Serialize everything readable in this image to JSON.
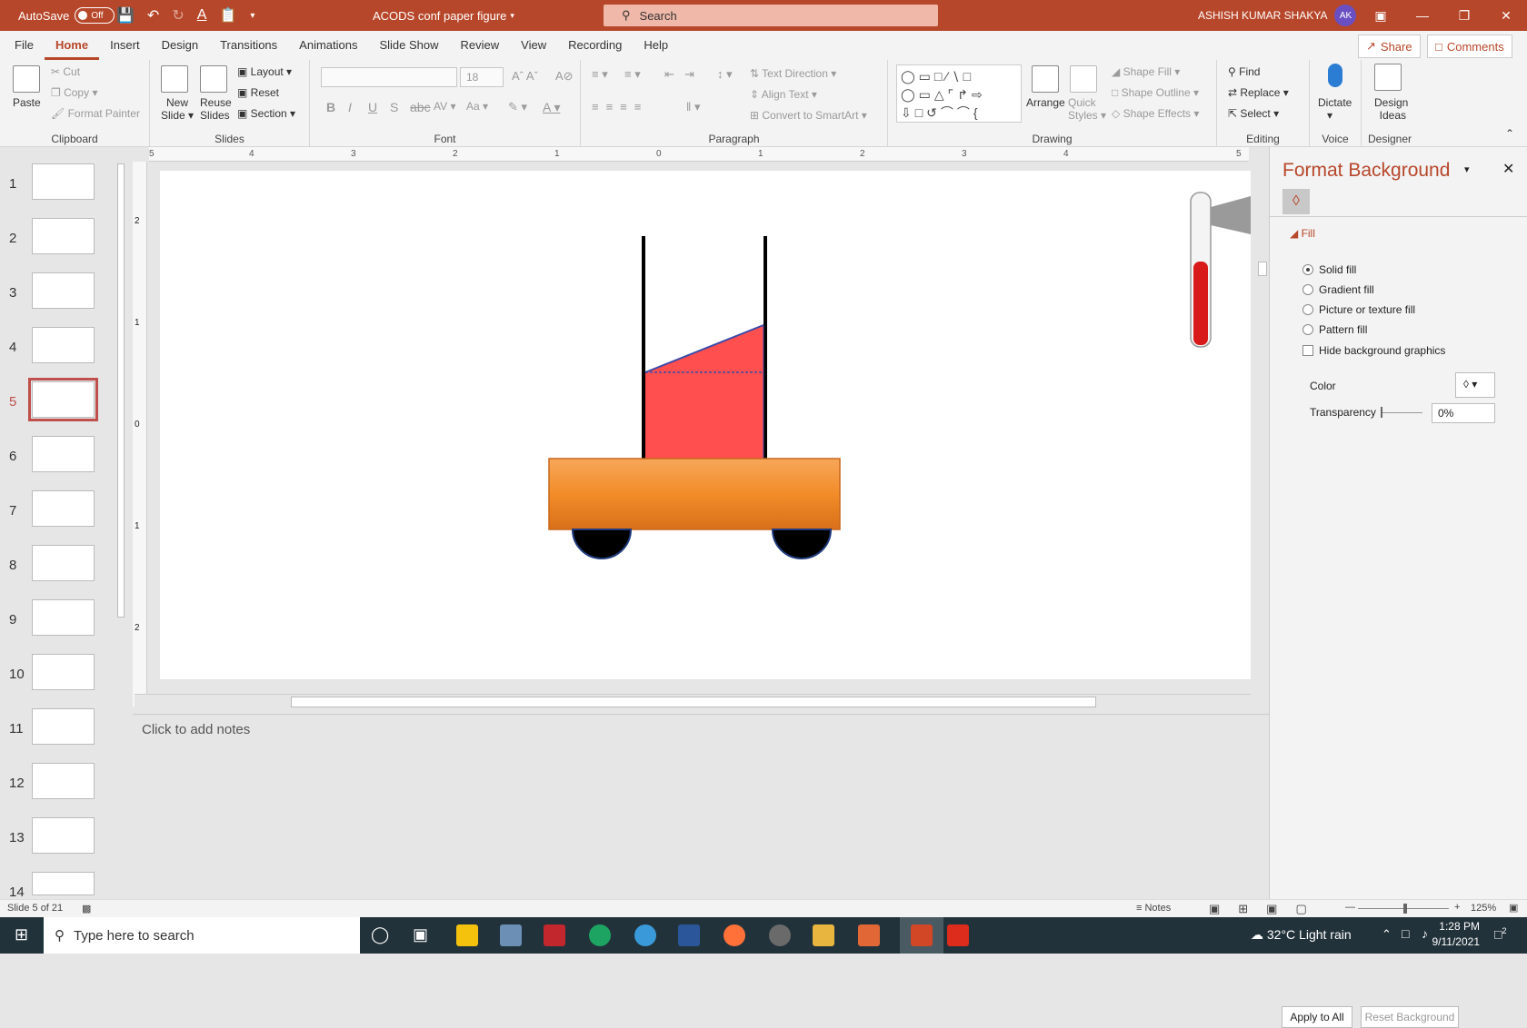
{
  "titlebar": {
    "autosave_label": "AutoSave",
    "autosave_state": "Off",
    "doc_title": "ACODS conf paper figure",
    "search_placeholder": "Search",
    "user_name": "ASHISH KUMAR SHAKYA",
    "user_initials": "AK"
  },
  "menu": {
    "tabs": [
      "File",
      "Home",
      "Insert",
      "Design",
      "Transitions",
      "Animations",
      "Slide Show",
      "Review",
      "View",
      "Recording",
      "Help"
    ],
    "active": "Home",
    "share_label": "Share",
    "comments_label": "Comments"
  },
  "ribbon": {
    "clipboard": {
      "label": "Clipboard",
      "paste": "Paste",
      "cut": "Cut",
      "copy": "Copy",
      "format_painter": "Format Painter"
    },
    "slides": {
      "label": "Slides",
      "new_slide": "New",
      "new_slide2": "Slide",
      "reuse": "Reuse",
      "reuse2": "Slides",
      "layout": "Layout",
      "reset": "Reset",
      "section": "Section"
    },
    "font": {
      "label": "Font",
      "size": "18"
    },
    "paragraph": {
      "label": "Paragraph",
      "text_direction": "Text Direction",
      "align_text": "Align Text",
      "convert_smartart": "Convert to SmartArt"
    },
    "drawing": {
      "label": "Drawing",
      "arrange": "Arrange",
      "quick_styles": "Quick",
      "quick_styles2": "Styles",
      "shape_fill": "Shape Fill",
      "shape_outline": "Shape Outline",
      "shape_effects": "Shape Effects"
    },
    "editing": {
      "label": "Editing",
      "find": "Find",
      "replace": "Replace",
      "select": "Select"
    },
    "voice": {
      "label": "Voice",
      "dictate": "Dictate"
    },
    "designer": {
      "label": "Designer",
      "design_ideas": "Design",
      "design_ideas2": "Ideas"
    }
  },
  "thumbnails": [
    "1",
    "2",
    "3",
    "4",
    "5",
    "6",
    "7",
    "8",
    "9",
    "10",
    "11",
    "12",
    "13",
    "14"
  ],
  "selected_slide": "5",
  "ruler": {
    "h_ticks": [
      "5",
      "4",
      "3",
      "2",
      "1",
      "0",
      "1",
      "2",
      "3",
      "4",
      "5"
    ],
    "v_ticks": [
      "2",
      "1",
      "0",
      "1",
      "2"
    ]
  },
  "notes_placeholder": "Click to add notes",
  "format_pane": {
    "title": "Format Background",
    "section": "Fill",
    "options": [
      "Solid fill",
      "Gradient fill",
      "Picture or texture fill",
      "Pattern fill"
    ],
    "selected_option": "Solid fill",
    "hide_graphics": "Hide background graphics",
    "color_label": "Color",
    "transparency_label": "Transparency",
    "transparency_value": "0%",
    "apply_all": "Apply to All",
    "reset_bg": "Reset Background"
  },
  "statusbar": {
    "slide_info": "Slide 5 of 21",
    "notes": "Notes",
    "zoom": "125%"
  },
  "taskbar": {
    "search_placeholder": "Type here to search",
    "weather": "32°C  Light rain",
    "time": "1:28 PM",
    "date": "9/11/2021",
    "notif_count": "2"
  },
  "colors": {
    "accent": "#b7472a",
    "cart_orange": "#f28c28",
    "liquid_red": "#ff4f4f",
    "wheel": "#000000",
    "taskbar": "#22323a"
  }
}
